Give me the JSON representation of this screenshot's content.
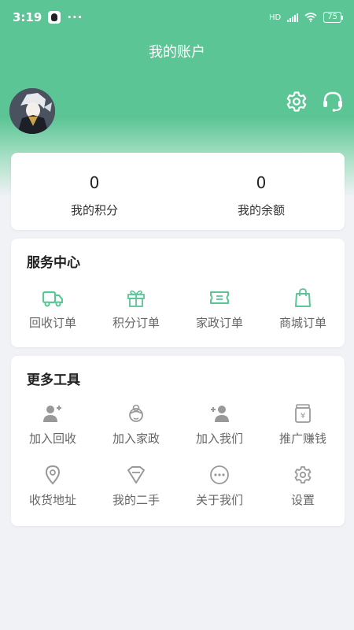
{
  "colors": {
    "accent": "#5cc596",
    "icon_gray": "#999999",
    "background": "#f0f2f6"
  },
  "status_bar": {
    "time": "3:19",
    "dots": "···",
    "network": "HD",
    "battery": "75"
  },
  "header": {
    "title": "我的账户",
    "settings_icon": "gear-icon",
    "support_icon": "headset-icon"
  },
  "stats": [
    {
      "value": "0",
      "label": "我的积分"
    },
    {
      "value": "0",
      "label": "我的余额"
    }
  ],
  "service_center": {
    "title": "服务中心",
    "items": [
      {
        "label": "回收订单",
        "icon": "truck-icon"
      },
      {
        "label": "积分订单",
        "icon": "gift-icon"
      },
      {
        "label": "家政订单",
        "icon": "ticket-icon"
      },
      {
        "label": "商城订单",
        "icon": "shopping-bag-icon"
      }
    ]
  },
  "more_tools": {
    "title": "更多工具",
    "items": [
      {
        "label": "加入回收",
        "icon": "user-plus-icon"
      },
      {
        "label": "加入家政",
        "icon": "housekeeper-icon"
      },
      {
        "label": "加入我们",
        "icon": "add-user-icon"
      },
      {
        "label": "推广赚钱",
        "icon": "money-jar-icon"
      },
      {
        "label": "收货地址",
        "icon": "location-pin-icon"
      },
      {
        "label": "我的二手",
        "icon": "diamond-icon"
      },
      {
        "label": "关于我们",
        "icon": "more-dots-icon"
      },
      {
        "label": "设置",
        "icon": "gear-icon"
      }
    ]
  }
}
